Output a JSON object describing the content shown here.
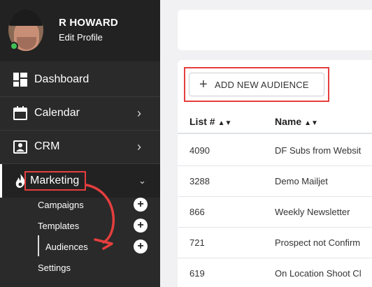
{
  "profile": {
    "name": "R HOWARD",
    "edit_label": "Edit Profile"
  },
  "nav": {
    "dashboard": "Dashboard",
    "calendar": "Calendar",
    "crm": "CRM",
    "marketing": "Marketing"
  },
  "marketing_sub": {
    "campaigns": "Campaigns",
    "templates": "Templates",
    "audiences": "Audiences",
    "settings": "Settings"
  },
  "main": {
    "add_button_label": "ADD NEW AUDIENCE",
    "columns": {
      "list": "List #",
      "name": "Name"
    },
    "rows": [
      {
        "id": "4090",
        "name": "DF Subs from Websit"
      },
      {
        "id": "3288",
        "name": "Demo Mailjet"
      },
      {
        "id": "866",
        "name": "Weekly Newsletter"
      },
      {
        "id": "721",
        "name": "Prospect not Confirm"
      },
      {
        "id": "619",
        "name": "On Location Shoot Cl"
      }
    ]
  },
  "colors": {
    "highlight": "#e53e3e",
    "sidebar": "#2a2a2a",
    "online": "#3fbf55"
  },
  "icons": [
    "dashboard-icon",
    "calendar-icon",
    "crm-icon",
    "flame-icon",
    "chevron-right-icon",
    "chevron-down-icon",
    "plus-icon",
    "sort-icon"
  ]
}
